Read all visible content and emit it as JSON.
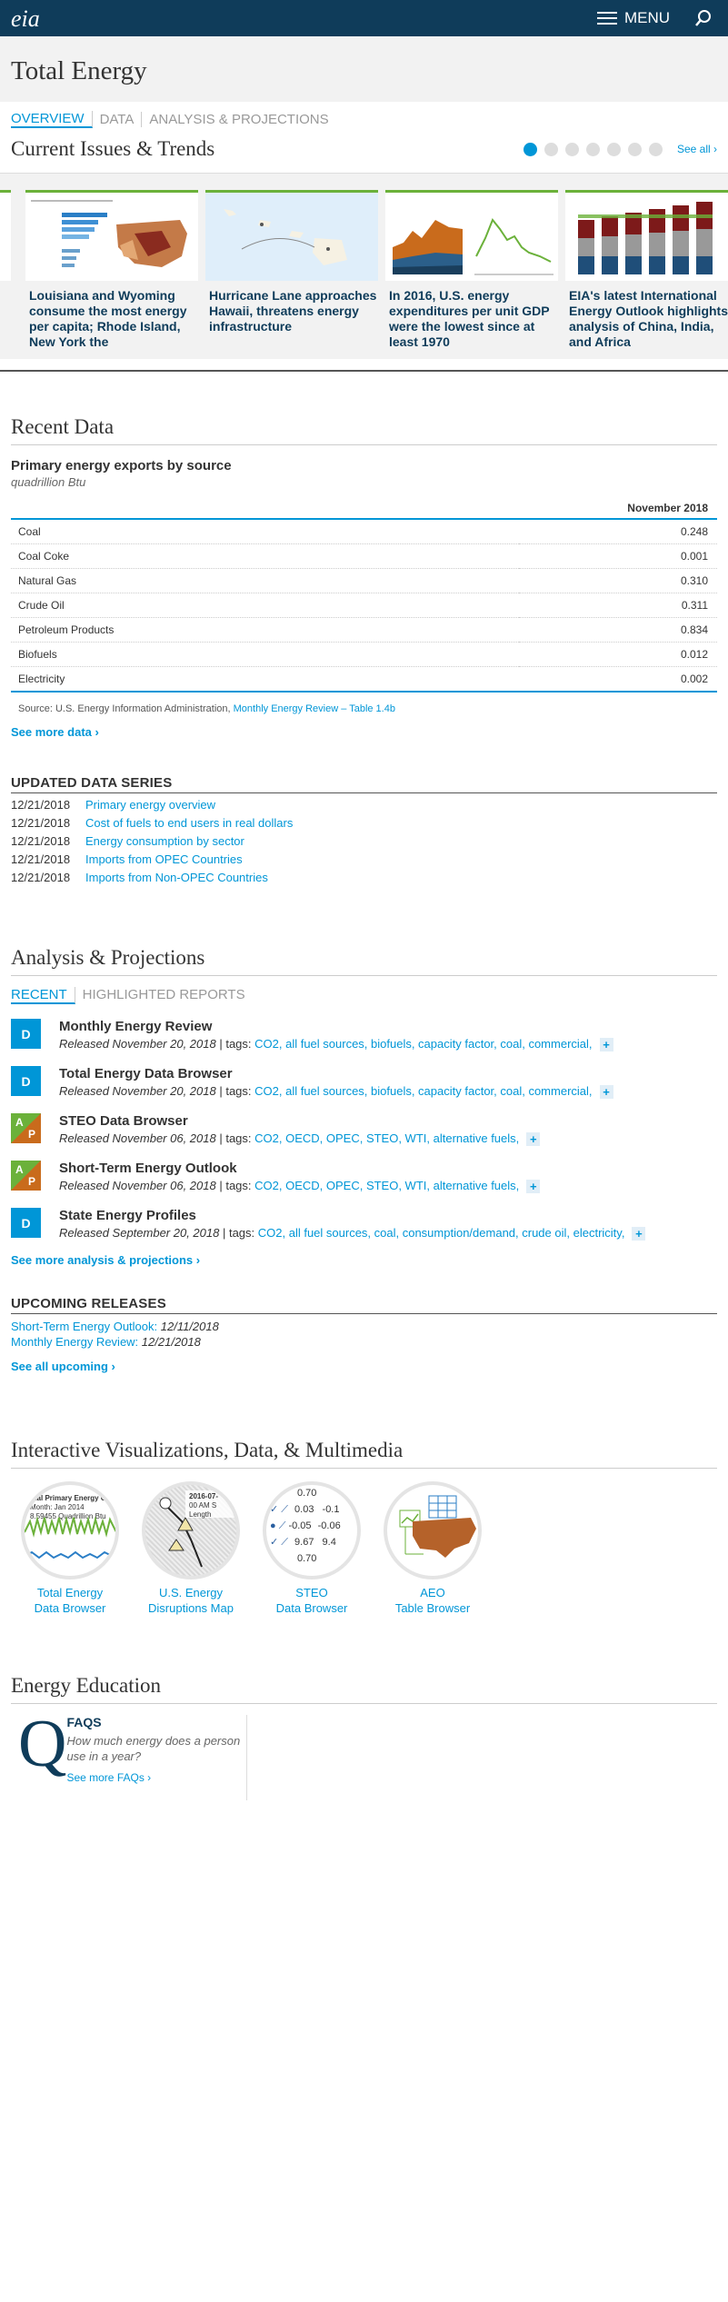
{
  "header": {
    "logo": "eia",
    "menu_label": "MENU"
  },
  "page": {
    "title": "Total Energy",
    "tabs": [
      "OVERVIEW",
      "DATA",
      "ANALYSIS & PROJECTIONS"
    ]
  },
  "trends": {
    "heading": "Current Issues & Trends",
    "see_all": "See all ›",
    "dot_count": 7,
    "cards": [
      {
        "caption": "Louisiana and Wyoming consume the most energy per capita; Rhode Island, New York the"
      },
      {
        "caption": "Hurricane Lane approaches Hawaii, threatens energy infrastructure"
      },
      {
        "caption": "In 2016, U.S. energy expenditures per unit GDP were the lowest since at least 1970"
      },
      {
        "caption": "EIA's latest International Energy Outlook highlights analysis of China, India, and Africa"
      }
    ]
  },
  "recent_data": {
    "heading": "Recent Data",
    "table_title": "Primary energy exports by source",
    "table_unit": "quadrillion Btu",
    "column_header": "November 2018",
    "rows": [
      {
        "label": "Coal",
        "value": "0.248"
      },
      {
        "label": "Coal Coke",
        "value": "0.001"
      },
      {
        "label": "Natural Gas",
        "value": "0.310"
      },
      {
        "label": "Crude Oil",
        "value": "0.311"
      },
      {
        "label": "Petroleum Products",
        "value": "0.834"
      },
      {
        "label": "Biofuels",
        "value": "0.012"
      },
      {
        "label": "Electricity",
        "value": "0.002"
      }
    ],
    "source_prefix": "Source: U.S. Energy Information Administration,",
    "source_link": "Monthly Energy Review – Table 1.4b",
    "see_more": "See more data ›"
  },
  "updated_series": {
    "heading": "UPDATED DATA SERIES",
    "items": [
      {
        "date": "12/21/2018",
        "title": "Primary energy overview"
      },
      {
        "date": "12/21/2018",
        "title": "Cost of fuels to end users in real dollars"
      },
      {
        "date": "12/21/2018",
        "title": "Energy consumption by sector"
      },
      {
        "date": "12/21/2018",
        "title": "Imports from OPEC Countries"
      },
      {
        "date": "12/21/2018",
        "title": "Imports from Non-OPEC Countries"
      }
    ]
  },
  "analysis": {
    "heading": "Analysis & Projections",
    "tabs": [
      "RECENT",
      "HIGHLIGHTED REPORTS"
    ],
    "items": [
      {
        "badge": "D",
        "title": "Monthly Energy Review",
        "released": "Released November 20, 2018",
        "tags": "CO2, all fuel sources, biofuels, capacity factor, coal, commercial,"
      },
      {
        "badge": "D",
        "title": "Total Energy Data Browser",
        "released": "Released November 20, 2018",
        "tags": "CO2, all fuel sources, biofuels, capacity factor, coal, commercial,"
      },
      {
        "badge": "AP",
        "title": "STEO Data Browser",
        "released": "Released November 06, 2018",
        "tags": "CO2, OECD, OPEC, STEO, WTI, alternative fuels,"
      },
      {
        "badge": "AP",
        "title": "Short-Term Energy Outlook",
        "released": "Released November 06, 2018",
        "tags": "CO2, OECD, OPEC, STEO, WTI, alternative fuels,"
      },
      {
        "badge": "D",
        "title": "State Energy Profiles",
        "released": "Released September 20, 2018",
        "tags": "CO2, all fuel sources, coal, consumption/demand, crude oil, electricity,"
      }
    ],
    "tags_sep": " | tags: ",
    "plus": "+",
    "see_more": "See more analysis & projections ›"
  },
  "upcoming": {
    "heading": "UPCOMING RELEASES",
    "items": [
      {
        "name": "Short-Term Energy Outlook:",
        "date": "12/11/2018"
      },
      {
        "name": "Monthly Energy Review:",
        "date": "12/21/2018"
      }
    ],
    "see_all": "See all upcoming ›"
  },
  "interactive": {
    "heading": "Interactive Visualizations, Data, & Multimedia",
    "items": [
      {
        "label_1": "Total Energy",
        "label_2": "Data Browser",
        "thumb_title": "otal Primary Energy Co",
        "thumb_line2": "Month: Jan 2014",
        "thumb_line3": "8.59455 Quadrillion Btu"
      },
      {
        "label_1": "U.S. Energy",
        "label_2": "Disruptions Map",
        "thumb_title": "2016-07-",
        "thumb_line2": "00 AM S",
        "thumb_line3": "Length"
      },
      {
        "label_1": "STEO",
        "label_2": "Data Browser",
        "thumb_values": [
          "0.70",
          "0.03",
          "-0.1",
          "-0.05",
          "-0.06",
          "9.67",
          "9.4",
          "0.70"
        ]
      },
      {
        "label_1": "AEO",
        "label_2": "Table Browser"
      }
    ]
  },
  "education": {
    "heading": "Energy Education",
    "faq_letter": "Q",
    "faq_title": "FAQS",
    "faq_question": "How much energy does a person use in a year?",
    "faq_more": "See more FAQs ›"
  },
  "colors": {
    "navy": "#0f3c5a",
    "link": "#0096d7",
    "green": "#6bb13a",
    "orange": "#c96b1c"
  }
}
